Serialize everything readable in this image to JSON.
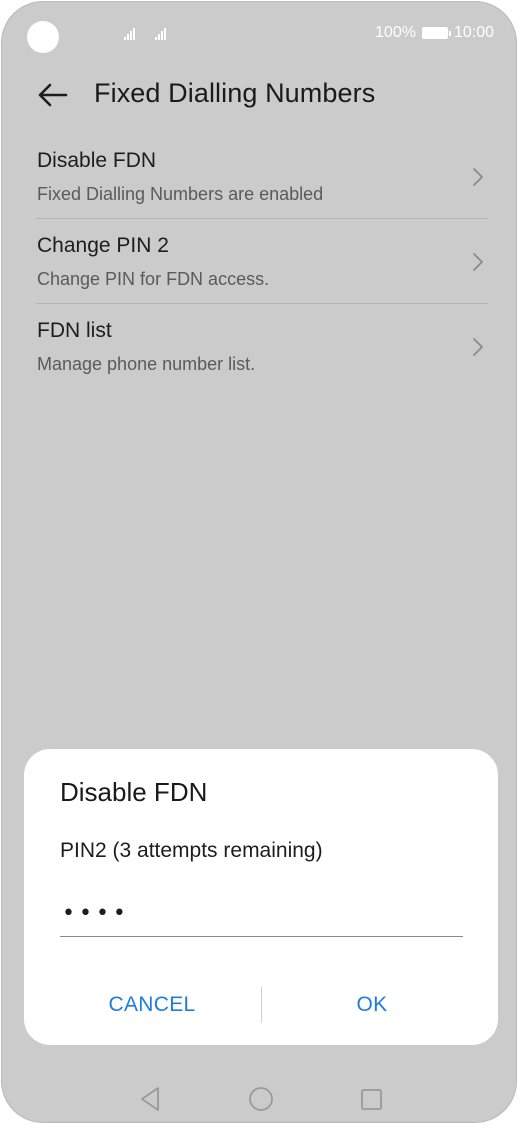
{
  "status_bar": {
    "battery_text": "100%",
    "time": "10:00"
  },
  "header": {
    "title": "Fixed Dialling Numbers",
    "back_icon": "back-arrow-icon"
  },
  "settings": {
    "items": [
      {
        "title": "Disable FDN",
        "subtitle": "Fixed Dialling Numbers are enabled"
      },
      {
        "title": "Change PIN 2",
        "subtitle": "Change PIN for FDN access."
      },
      {
        "title": "FDN list",
        "subtitle": "Manage phone number list."
      }
    ]
  },
  "dialog": {
    "title": "Disable FDN",
    "message": "PIN2 (3 attempts remaining)",
    "pin_value": "1234",
    "cancel_label": "CANCEL",
    "ok_label": "OK"
  },
  "colors": {
    "accent": "#1f7de0",
    "background_dimmed": "#cbcbcb",
    "dialog_background": "#ffffff"
  }
}
